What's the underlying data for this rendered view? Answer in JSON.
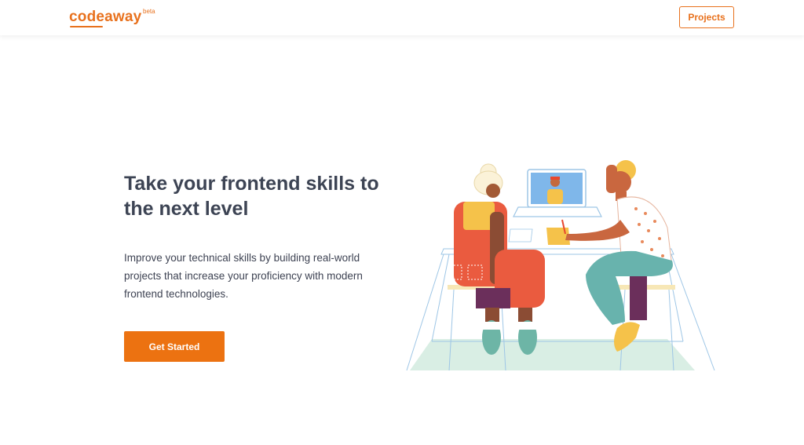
{
  "header": {
    "logo_text": "codeaway",
    "logo_badge": "beta",
    "projects_label": "Projects"
  },
  "hero": {
    "title": "Take your frontend skills to the next level",
    "description": "Improve your technical skills by building real-world projects that increase your proficiency with modern frontend technologies.",
    "cta_label": "Get Started"
  },
  "colors": {
    "accent": "#e8711d",
    "cta": "#ec7211",
    "heading": "#3d4454",
    "text": "#3e4353"
  },
  "illustration": {
    "subject": "two-people-working-at-desk-with-laptop-illustration"
  }
}
